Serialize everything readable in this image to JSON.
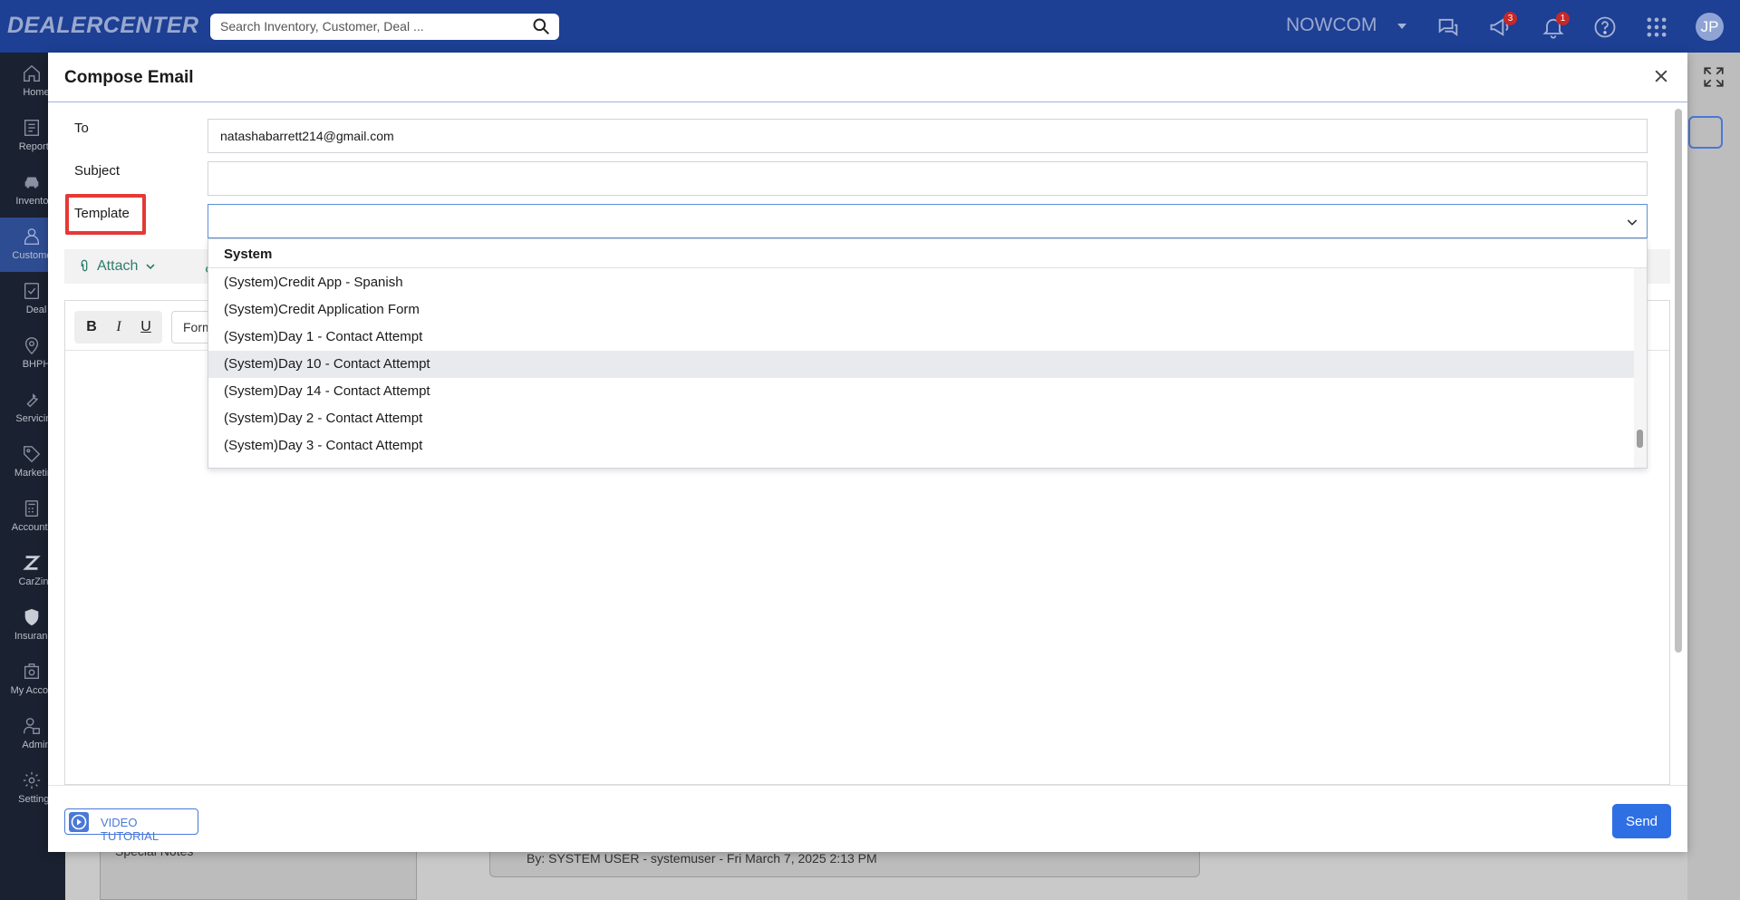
{
  "topbar": {
    "logo": "DEALERCENTER",
    "search_placeholder": "Search Inventory, Customer, Deal ...",
    "brand": "NOWCOM",
    "announcement_badge": "3",
    "notification_badge": "1",
    "avatar_initials": "JP"
  },
  "leftnav": {
    "items": [
      {
        "label": "Home",
        "icon": "home-icon"
      },
      {
        "label": "Reports",
        "icon": "reports-icon"
      },
      {
        "label": "Inventory",
        "icon": "car-icon"
      },
      {
        "label": "Customers",
        "icon": "customer-icon"
      },
      {
        "label": "Deal",
        "icon": "deal-icon"
      },
      {
        "label": "BHPH",
        "icon": "location-icon"
      },
      {
        "label": "Servicing",
        "icon": "wrench-icon"
      },
      {
        "label": "Marketing",
        "icon": "tag-icon"
      },
      {
        "label": "Accounting",
        "icon": "calculator-icon"
      },
      {
        "label": "CarZing",
        "icon": "carzing-icon"
      },
      {
        "label": "Insurance",
        "icon": "shield-icon"
      },
      {
        "label": "My Account",
        "icon": "account-icon"
      },
      {
        "label": "Admin",
        "icon": "admin-icon"
      },
      {
        "label": "Settings",
        "icon": "gear-icon"
      }
    ]
  },
  "modal": {
    "title": "Compose Email",
    "to_label": "To",
    "to_value": "natashabarrett214@gmail.com",
    "subject_label": "Subject",
    "subject_value": "",
    "template_label": "Template",
    "attach_label": "Attach",
    "bold_label": "B",
    "italic_label": "I",
    "underline_label": "U",
    "format_label": "Format",
    "video_tutorial_label": "VIDEO TUTORIAL",
    "send_label": "Send"
  },
  "template_dropdown": {
    "group_label": "System",
    "items": [
      "(System)Credit App - Spanish",
      "(System)Credit Application Form",
      "(System)Day 1 - Contact Attempt",
      "(System)Day 10 - Contact Attempt",
      "(System)Day 14 - Contact Attempt",
      "(System)Day 2 - Contact Attempt",
      "(System)Day 3 - Contact Attempt"
    ],
    "hovered_index": 3
  },
  "background": {
    "note_byline": "By: SYSTEM USER - systemuser - Fri March 7, 2025 2:13 PM",
    "special_notes_label": "Special Notes"
  },
  "colors": {
    "topbar": "#1d3f94",
    "leftnav": "#1a2130",
    "accent": "#2f6fe4",
    "highlight": "#e53935"
  }
}
